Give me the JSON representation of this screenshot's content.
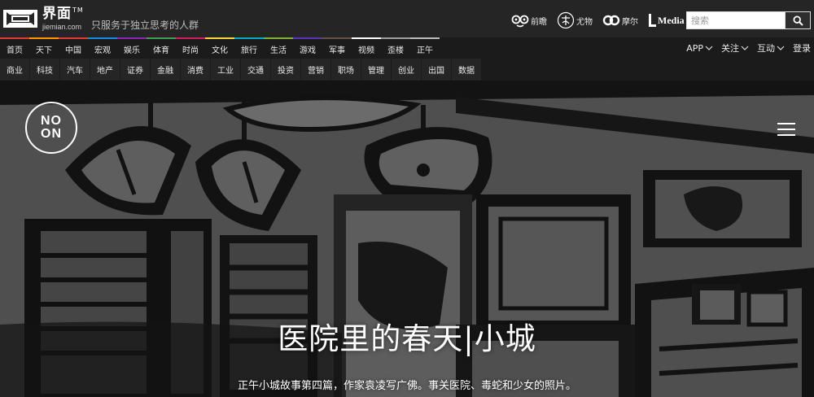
{
  "header": {
    "logo_cn": "界面",
    "logo_tm": "TM",
    "logo_url": "jiemian.com",
    "slogan": "只服务于独立思考的人群",
    "partners": [
      {
        "label": "前瞻",
        "icon": "glasses-icon"
      },
      {
        "label": "尤物",
        "icon": "youwu-seal-icon"
      },
      {
        "label": "摩尔",
        "icon": "infinity-icon"
      },
      {
        "label": "Media",
        "icon": "media-logo-icon"
      }
    ],
    "search": {
      "placeholder": "搜索",
      "icon": "search-icon"
    }
  },
  "nav": {
    "primary": [
      {
        "label": "首页",
        "color": "#e53935"
      },
      {
        "label": "天下",
        "color": "#ff9800"
      },
      {
        "label": "中国",
        "color": "#e53935"
      },
      {
        "label": "宏观",
        "color": "#1e88e5"
      },
      {
        "label": "娱乐",
        "color": "#8e24aa"
      },
      {
        "label": "体育",
        "color": "#43a047"
      },
      {
        "label": "时尚",
        "color": "#d81b60"
      },
      {
        "label": "文化",
        "color": "#fdd835"
      },
      {
        "label": "旅行",
        "color": "#00acc1"
      },
      {
        "label": "生活",
        "color": "#7cb342"
      },
      {
        "label": "游戏",
        "color": "#5e35b1"
      },
      {
        "label": "军事",
        "color": "#6d4c41"
      },
      {
        "label": "视频",
        "color": "#ffffff"
      },
      {
        "label": "歪楼",
        "color": "#9e9e9e"
      },
      {
        "label": "正午",
        "color": "#bdbdbd"
      }
    ],
    "secondary": [
      "商业",
      "科技",
      "汽车",
      "地产",
      "证券",
      "金融",
      "消费",
      "工业",
      "交通",
      "投资",
      "营销",
      "职场",
      "管理",
      "创业",
      "出国",
      "数据"
    ],
    "right": [
      {
        "label": "APP",
        "has_dropdown": true
      },
      {
        "label": "关注",
        "has_dropdown": true
      },
      {
        "label": "互动",
        "has_dropdown": true
      },
      {
        "label": "登录",
        "has_dropdown": false
      }
    ]
  },
  "hero": {
    "badge_top": "NO",
    "badge_bottom": "ON",
    "title": "医院里的春天|小城",
    "subtitle": "正午小城故事第四篇，作家袁凌写广佛。事关医院、毒蛇和少女的照片。",
    "menu_icon": "hamburger-menu-icon"
  },
  "colors": {
    "header_bg": "#252525",
    "nav_bg": "#1b1b1b",
    "hero_bg": "#5f5f5f",
    "ink": "#141414"
  }
}
